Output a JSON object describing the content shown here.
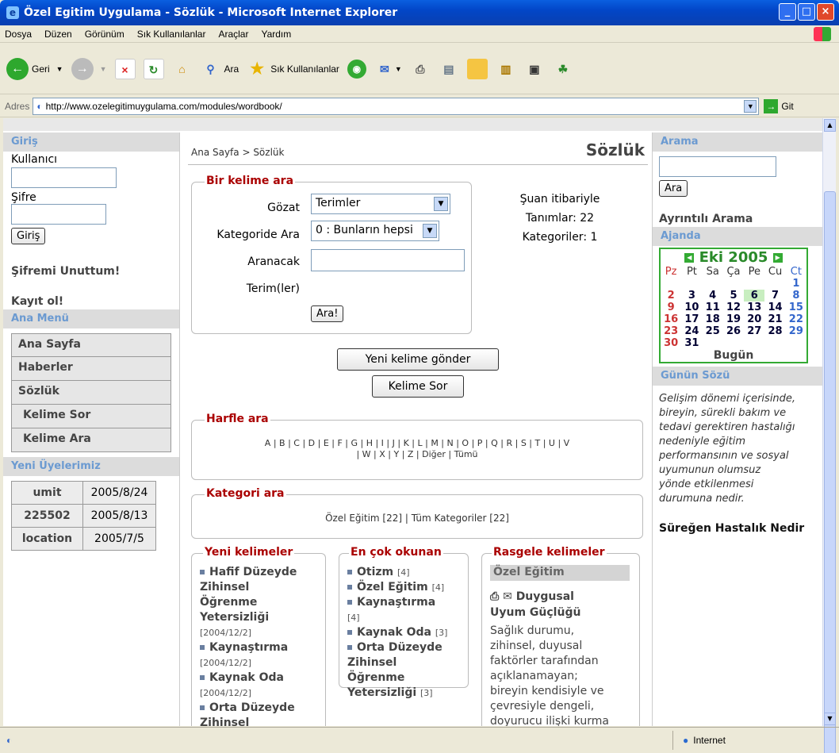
{
  "window": {
    "title": "Özel Egitim Uygulama - Sözlük - Microsoft Internet Explorer"
  },
  "menubar": [
    "Dosya",
    "Düzen",
    "Görünüm",
    "Sık Kullanılanlar",
    "Araçlar",
    "Yardım"
  ],
  "toolbar": {
    "back": "Geri",
    "search": "Ara",
    "favorites": "Sık Kullanılanlar"
  },
  "address": {
    "label": "Adres",
    "url": "http://www.ozelegitimuygulama.com/modules/wordbook/",
    "go": "Git"
  },
  "status": {
    "zone": "Internet"
  },
  "left": {
    "login_header": "Giriş",
    "user_label": "Kullanıcı",
    "pass_label": "Şifre",
    "login_btn": "Giriş",
    "forgot": "Şifremi Unuttum!",
    "register": "Kayıt ol!",
    "menu_header": "Ana Menü",
    "menu": [
      "Ana Sayfa",
      "Haberler",
      "Sözlük",
      "Kelime Sor",
      "Kelime Ara"
    ],
    "members_header": "Yeni Üyelerimiz",
    "members": [
      [
        "umit",
        "2005/8/24"
      ],
      [
        "225502",
        "2005/8/13"
      ],
      [
        "location",
        "2005/7/5"
      ]
    ]
  },
  "center": {
    "breadcrumb": "Ana Sayfa > Sözlük",
    "page_title": "Sözlük",
    "search_legend": "Bir kelime ara",
    "browse_label": "Gözat",
    "browse_value": "Terimler",
    "category_label": "Kategoride Ara",
    "category_value": "0 : Bunların hepsi",
    "term_label_1": "Aranacak",
    "term_label_2": "Terim(ler)",
    "search_btn": "Ara!",
    "stats_1": "Şuan itibariyle",
    "stats_2": "Tanımlar: 22",
    "stats_3": "Kategoriler: 1",
    "submit_btn": "Yeni kelime gönder",
    "ask_btn": "Kelime Sor",
    "letter_legend": "Harfle ara",
    "letters_1": "A | B | C | D | E | F | G | H | I | J | K | L | M | N | O | P | Q | R | S | T | U | V",
    "letters_2": "| W | X | Y | Z | Diğer | Tümü",
    "cat_legend": "Kategori ara",
    "cat_links": "Özel Eğitim [22] | Tüm Kategoriler [22]",
    "new_legend": "Yeni kelimeler",
    "popular_legend": "En çok okunan",
    "random_legend": "Rasgele kelimeler",
    "new_items": [
      {
        "t1": "Hafif Düzeyde",
        "t2": "Zihinsel",
        "t3": "Öğrenme",
        "t4": "Yetersizliği",
        "d": "[2004/12/2]"
      },
      {
        "t1": "Kaynaştırma",
        "d": "[2004/12/2]"
      },
      {
        "t1": "Kaynak Oda",
        "d": "[2004/12/2]"
      },
      {
        "t1": "Orta Düzeyde",
        "t2": "Zihinsel"
      }
    ],
    "popular_items": [
      {
        "t": "Otizm",
        "c": "[4]"
      },
      {
        "t": "Özel Eğitim",
        "c": "[4]"
      },
      {
        "t": "Kaynaştırma",
        "c": "[4]"
      },
      {
        "t": "Kaynak Oda",
        "c": "[3]"
      },
      {
        "t": "Orta Düzeyde",
        "t2": "Zihinsel",
        "t3": "Öğrenme",
        "t4": "Yetersizliği",
        "c": "[3]"
      }
    ],
    "random_cat": "Özel Eğitim",
    "random_term_1": "Duygusal",
    "random_term_2": "Uyum Güçlüğü",
    "random_desc": [
      "Sağlık durumu,",
      "zihinsel, duyusal",
      "faktörler tarafından",
      "açıklanamayan;",
      "bireyin kendisiyle ve",
      "çevresiyle dengeli,",
      "doyurucu ilişki kurma"
    ]
  },
  "right": {
    "search_header": "Arama",
    "search_btn": "Ara",
    "adv_search": "Ayrıntılı Arama",
    "agenda_header": "Ajanda",
    "cal_title": "Eki 2005",
    "weekdays": [
      "Pz",
      "Pt",
      "Sa",
      "Ça",
      "Pe",
      "Cu",
      "Ct"
    ],
    "weeks": [
      [
        "",
        "",
        "",
        "",
        "",
        "",
        "1"
      ],
      [
        "2",
        "3",
        "4",
        "5",
        "6",
        "7",
        "8"
      ],
      [
        "9",
        "10",
        "11",
        "12",
        "13",
        "14",
        "15"
      ],
      [
        "16",
        "17",
        "18",
        "19",
        "20",
        "21",
        "22"
      ],
      [
        "23",
        "24",
        "25",
        "26",
        "27",
        "28",
        "29"
      ],
      [
        "30",
        "31",
        "",
        "",
        "",
        "",
        ""
      ]
    ],
    "today_label": "Bugün",
    "quote_header": "Günün Sözü",
    "quote_lines": [
      "Gelişim dönemi içerisinde,",
      "bireyin, sürekli bakım ve",
      "tedavi gerektiren hastalığı",
      "nedeniyle eğitim",
      "performansının ve sosyal",
      "uyumunun olumsuz",
      "yönde etkilenmesi",
      "durumuna nedir."
    ],
    "quote_title": "Süreğen Hastalık Nedir"
  }
}
